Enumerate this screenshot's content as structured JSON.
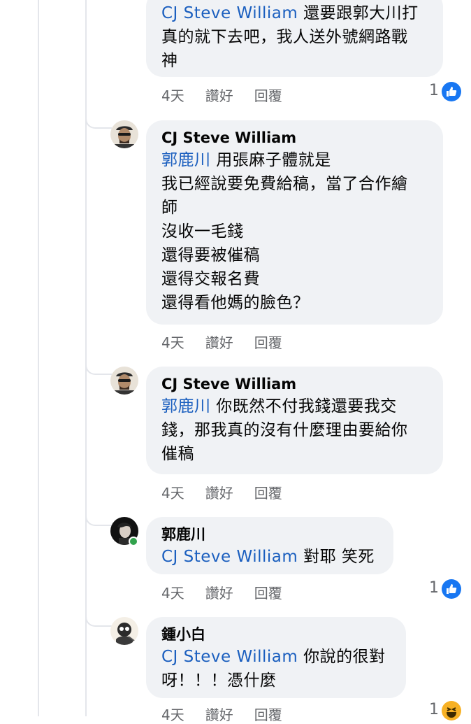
{
  "comments": [
    {
      "author": "",
      "mention": "CJ Steve William",
      "text": " 還要跟郭大川打\n真的就下去吧，我人送外號網路戰\n神",
      "time": "4天",
      "like_label": "讚好",
      "reply_label": "回覆",
      "reaction_count": "1",
      "reaction": "like"
    },
    {
      "author": "CJ Steve William",
      "mention": "郭鹿川",
      "text": " 用張麻子體就是\n我已經說要免費給稿，當了合作繪\n師\n沒收一毛錢\n還得要被催稿\n還得交報名費\n還得看他媽的臉色？",
      "time": "4天",
      "like_label": "讚好",
      "reply_label": "回覆"
    },
    {
      "author": "CJ Steve William",
      "mention": "郭鹿川",
      "text": " 你既然不付我錢還要我交\n錢，那我真的沒有什麼理由要給你\n催稿",
      "time": "4天",
      "like_label": "讚好",
      "reply_label": "回覆"
    },
    {
      "author": "郭鹿川",
      "mention": "CJ Steve William",
      "text": " 對耶 笑死",
      "time": "4天",
      "like_label": "讚好",
      "reply_label": "回覆",
      "reaction_count": "1",
      "reaction": "like"
    },
    {
      "author": "鍾小白",
      "mention": "CJ Steve William",
      "text": " 你說的很對\n呀！！！憑什麼",
      "time": "4天",
      "like_label": "讚好",
      "reply_label": "回覆",
      "reaction_count": "1",
      "reaction": "haha"
    }
  ],
  "colors": {
    "mention": "#1b5fbf",
    "bubble": "#f0f2f5",
    "like_blue": "#1877f2",
    "muted": "#65676b"
  },
  "icons": [
    "thumbs-up-icon",
    "haha-emoji-icon",
    "online-status-icon"
  ]
}
